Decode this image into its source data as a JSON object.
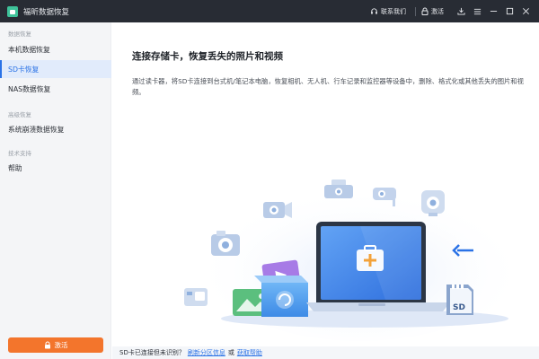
{
  "titlebar": {
    "app_title": "福昕数据恢复",
    "contact_label": "联系我们",
    "activate_label": "激活"
  },
  "sidebar": {
    "groups": [
      {
        "title": "数据恢复",
        "items": [
          {
            "label": "本机数据恢复",
            "active": false
          },
          {
            "label": "SD卡恢复",
            "active": true
          },
          {
            "label": "NAS数据恢复",
            "active": false
          }
        ]
      },
      {
        "title": "高级恢复",
        "items": [
          {
            "label": "系统崩溃数据恢复",
            "active": false
          }
        ]
      },
      {
        "title": "技术支持",
        "items": [
          {
            "label": "帮助",
            "active": false
          }
        ]
      }
    ],
    "activate_button": "激活"
  },
  "main": {
    "title": "连接存储卡，恢复丢失的照片和视频",
    "description": "通过读卡器，将SD卡连接到台式机/笔记本电脑，恢复相机、无人机、行车记录和监控器等设备中，删除、格式化或其他丢失的图片和视频。",
    "sd_label": "SD"
  },
  "footer": {
    "prefix": "SD卡已连接但未识别？",
    "link1": "刷新分区信息",
    "mid": "或",
    "link2": "获取帮助"
  },
  "colors": {
    "titlebar": "#282c34",
    "accent": "#2a72e6",
    "activate": "#f3752c",
    "sidebar_bg": "#f4f5f7"
  }
}
